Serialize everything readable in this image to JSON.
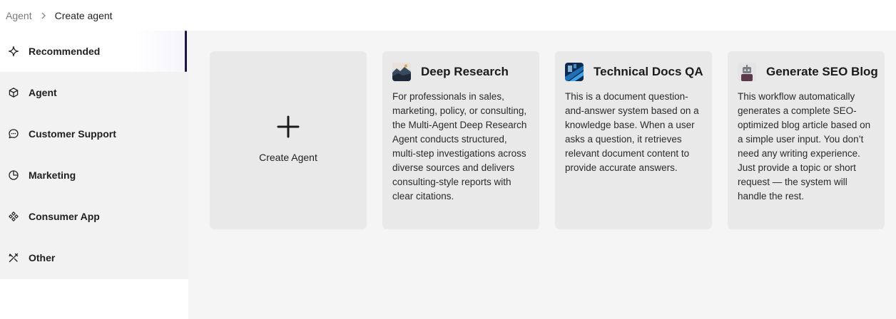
{
  "breadcrumb": {
    "parent": "Agent",
    "current": "Create agent"
  },
  "sidebar": {
    "items": [
      {
        "label": "Recommended",
        "icon": "sparkle-icon",
        "active": true
      },
      {
        "label": "Agent",
        "icon": "cube-icon"
      },
      {
        "label": "Customer Support",
        "icon": "chat-bubble-icon"
      },
      {
        "label": "Marketing",
        "icon": "pie-chart-icon"
      },
      {
        "label": "Consumer App",
        "icon": "grid-diamond-icon"
      },
      {
        "label": "Other",
        "icon": "tools-icon"
      }
    ]
  },
  "create_card": {
    "label": "Create Agent",
    "icon": "plus-icon"
  },
  "templates": [
    {
      "title": "Deep Research",
      "description": "For professionals in sales, marketing, policy, or consulting, the Multi-Agent Deep Research Agent conducts structured, multi-step investigations across diverse sources and delivers consulting-style reports with clear citations.",
      "thumbnail": "landscape-thumbnail"
    },
    {
      "title": "Technical Docs QA",
      "description": "This is a document question-and-answer system based on a knowledge base. When a user asks a question, it retrieves relevant document content to provide accurate answers.",
      "thumbnail": "blue-abstract-thumbnail"
    },
    {
      "title": "Generate SEO Blog",
      "description": "This workflow automatically generates a complete SEO-optimized blog article based on a simple user input. You don’t need any writing experience. Just provide a topic or short request — the system will handle the rest.",
      "thumbnail": "robot-thumbnail"
    }
  ],
  "colors": {
    "active_indicator": "#1a1640",
    "sidebar_bg": "#f2f2f2",
    "card_bg": "#e9e9e9",
    "main_bg": "#f5f5f5"
  }
}
